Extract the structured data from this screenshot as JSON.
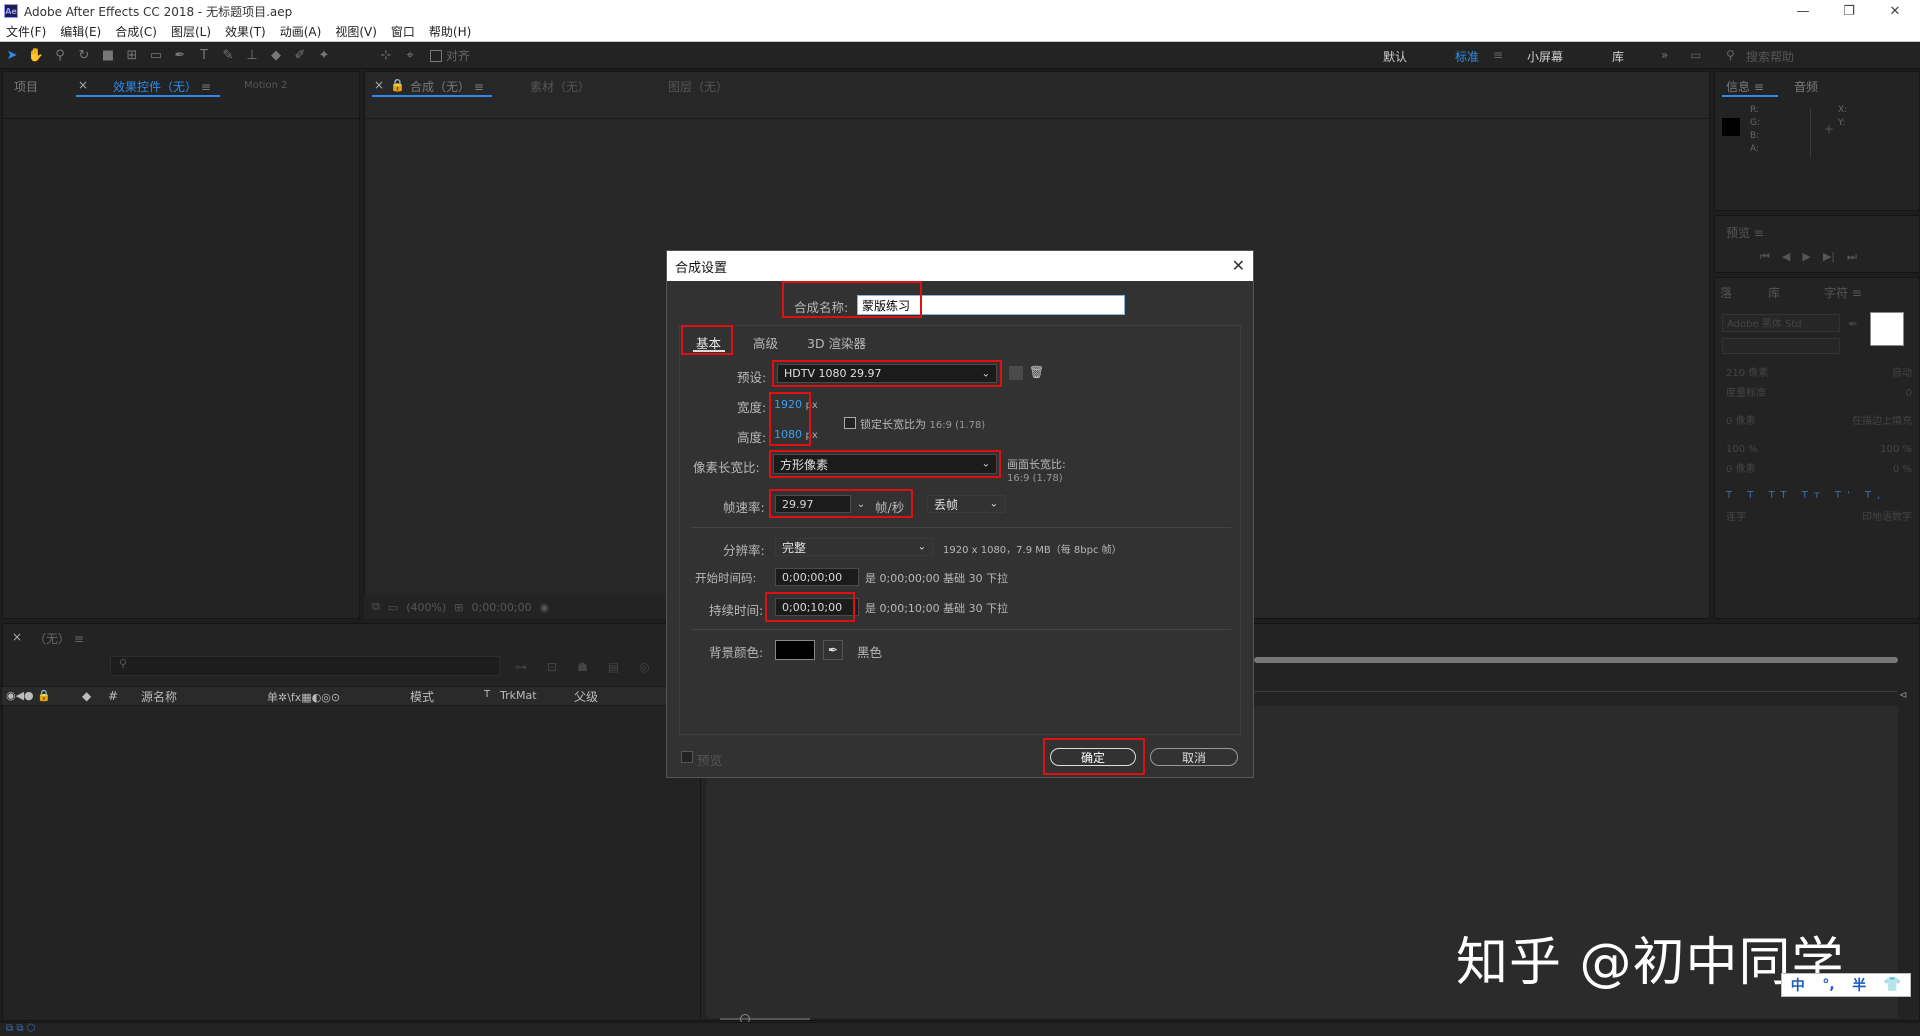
{
  "window": {
    "title": "Adobe After Effects CC 2018 - 无标题项目.aep",
    "logo": "Ae",
    "minimize": "—",
    "restore": "❐",
    "close": "✕"
  },
  "menu": [
    "文件(F)",
    "编辑(E)",
    "合成(C)",
    "图层(L)",
    "效果(T)",
    "动画(A)",
    "视图(V)",
    "窗口",
    "帮助(H)"
  ],
  "toolbar": {
    "align_label": "对齐",
    "workspaces": [
      "默认",
      "标准",
      "小屏幕",
      "库"
    ],
    "active_workspace": "标准",
    "more": "»",
    "search_placeholder": "搜索帮助"
  },
  "panels": {
    "project_tab": "项目",
    "effects_tab": "效果控件（无）",
    "motion_tab": "Motion 2",
    "comp_tab": "合成（无）",
    "footage_tab": "素材（无）",
    "layer_tab": "图层（无）",
    "info_tab": "信息",
    "audio_tab": "音频",
    "info_rgb": [
      "R:",
      "G:",
      "B:",
      "A:"
    ],
    "info_xy": [
      "X:",
      "Y:"
    ],
    "preview_tab": "预览",
    "char_tabs": [
      "落",
      "库",
      "字符"
    ],
    "font_name": "Adobe 黑体 Std",
    "char_rows": [
      "210 像素",
      "自动",
      "度量标准",
      "0",
      "0 像素",
      "在描边上填充",
      "100 %",
      "100 %",
      "0 像素",
      "0 %"
    ],
    "char_checks": [
      "连字",
      "印地语数字"
    ],
    "viewer_zoom": "(400%)",
    "viewer_time": "0;00;00;00"
  },
  "timeline": {
    "tab": "（无）",
    "search_placeholder": "",
    "col_source": "源名称",
    "col_mode": "模式",
    "col_t": "T",
    "col_trkmat": "TrkMat",
    "col_parent": "父级",
    "col_num": "#"
  },
  "dialog": {
    "title": "合成设置",
    "name_label": "合成名称:",
    "name_value": "蒙版练习",
    "tabs": [
      "基本",
      "高级",
      "3D 渲染器"
    ],
    "preset_label": "预设:",
    "preset_value": "HDTV 1080 29.97",
    "width_label": "宽度:",
    "width_value": "1920",
    "height_label": "高度:",
    "height_value": "1080",
    "unit_px": "px",
    "lock_label": "锁定长宽比为",
    "lock_ratio": "16:9 (1.78)",
    "pixel_aspect_label": "像素长宽比:",
    "pixel_aspect_value": "方形像素",
    "frame_aspect_label": "画面长宽比:",
    "frame_aspect_value": "16:9 (1.78)",
    "fps_label": "帧速率:",
    "fps_value": "29.97",
    "fps_unit": "帧/秒",
    "drop_frame": "丢帧",
    "resolution_label": "分辨率:",
    "resolution_value": "完整",
    "resolution_info": "1920 x 1080，7.9 MB（每 8bpc 帧）",
    "start_tc_label": "开始时间码:",
    "start_tc_value": "0;00;00;00",
    "start_tc_info": "是 0;00;00;00  基础 30  下拉",
    "duration_label": "持续时间:",
    "duration_value": "0;00;10;00",
    "duration_info": "是 0;00;10;00  基础 30  下拉",
    "bg_label": "背景颜色:",
    "bg_color": "#000000",
    "bg_name": "黑色",
    "preview_label": "预览",
    "ok": "确定",
    "cancel": "取消"
  },
  "watermark": "知乎 @初中同学",
  "ime": [
    "中",
    "°,",
    "半",
    "👕"
  ],
  "colors": {
    "accent": "#2d8ceb",
    "highlight": "#e01010"
  }
}
